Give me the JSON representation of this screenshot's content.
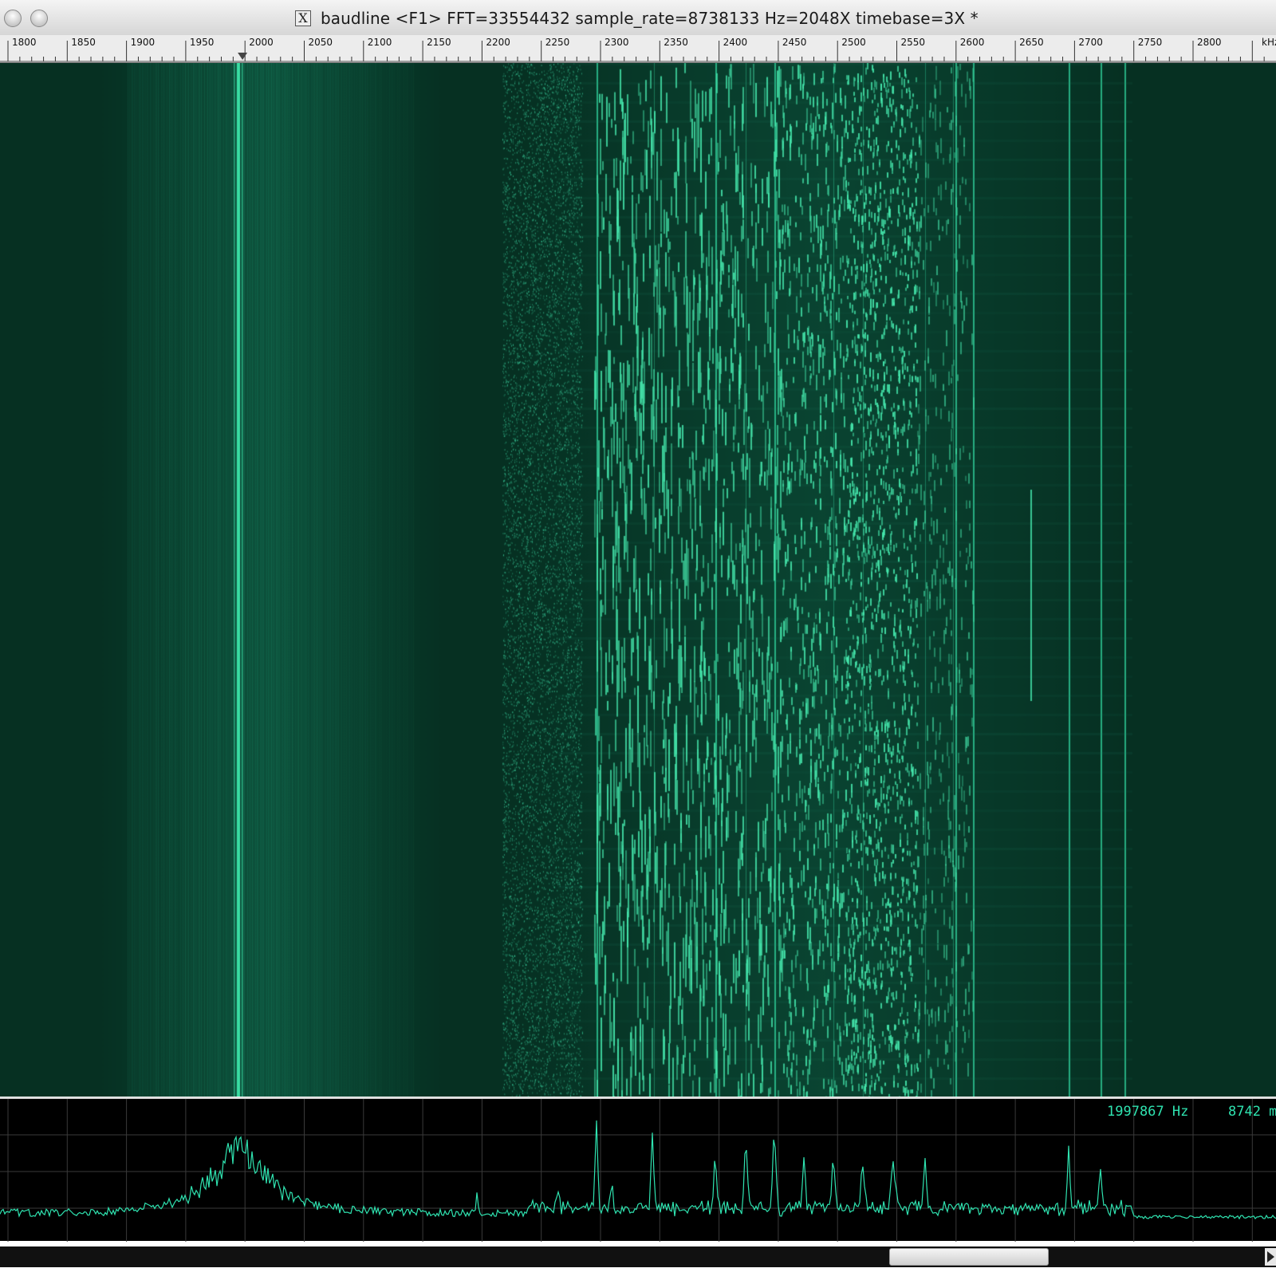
{
  "window": {
    "title": "baudline   <F1> FFT=33554432 sample_rate=8738133 Hz=2048X timebase=3X  *",
    "x_button_label": "X"
  },
  "ruler": {
    "unit_label": "kHz",
    "ticks": [
      "1800",
      "1850",
      "1900",
      "1950",
      "2000",
      "2050",
      "2100",
      "2150",
      "2200",
      "2250",
      "2300",
      "2350",
      "2400",
      "2450",
      "2500",
      "2550",
      "2600",
      "2650",
      "2700",
      "2750",
      "2800"
    ],
    "cursor_khz": 1997.9
  },
  "spectrum": {
    "cursor_readout": "1997867 Hz",
    "magnitude_readout": "8742 m"
  },
  "colors": {
    "spectrogram_bg": "#063022",
    "signal": "#2fe3b0",
    "grid": "#3a3a3a"
  },
  "icons": {
    "close": "traffic-light-close-icon",
    "minimize": "traffic-light-minimize-icon",
    "x11": "x11-icon",
    "cursor": "cursor-marker-icon",
    "scroll_right": "scroll-right-arrow-icon"
  }
}
